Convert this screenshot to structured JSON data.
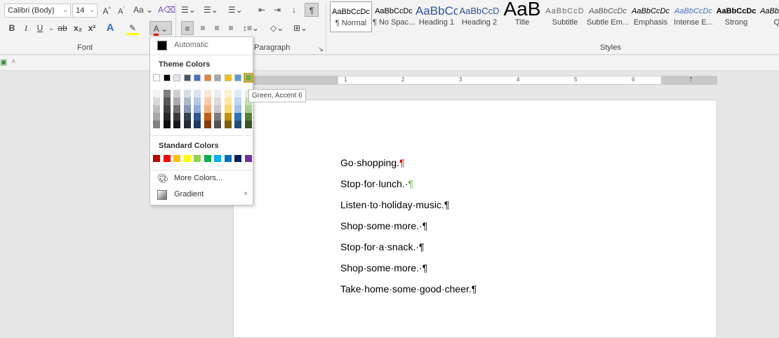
{
  "ribbon": {
    "font_name": "Calibri (Body)",
    "font_size": "14",
    "case_label": "Aa",
    "font_group": "Font",
    "paragraph_group": "Paragraph",
    "styles_group": "Styles",
    "bold": "B",
    "italic": "I",
    "underline": "U",
    "strike": "ab",
    "subscript": "x₂",
    "superscript": "x²",
    "styles": [
      {
        "preview": "AaBbCcDc",
        "name": "¶ Normal"
      },
      {
        "preview": "AaBbCcDc",
        "name": "¶ No Spac..."
      },
      {
        "preview": "AaBbCc",
        "name": "Heading 1"
      },
      {
        "preview": "AaBbCcD",
        "name": "Heading 2"
      },
      {
        "preview": "AaB",
        "name": "Title"
      },
      {
        "preview": "AaBbCcD",
        "name": "Subtitle"
      },
      {
        "preview": "AaBbCcDc",
        "name": "Subtle Em..."
      },
      {
        "preview": "AaBbCcDc",
        "name": "Emphasis"
      },
      {
        "preview": "AaBbCcDc",
        "name": "Intense E..."
      },
      {
        "preview": "AaBbCcDc",
        "name": "Strong"
      },
      {
        "preview": "AaBbCcDc",
        "name": "Qu"
      }
    ]
  },
  "ruler": {
    "numbers": [
      "1",
      "2",
      "3",
      "4",
      "5",
      "6",
      "7"
    ]
  },
  "font_color_menu": {
    "automatic": "Automatic",
    "theme_header": "Theme Colors",
    "standard_header": "Standard Colors",
    "more_colors": "More Colors...",
    "gradient": "Gradient",
    "tooltip": "Green, Accent 6",
    "theme_colors": [
      "#ffffff",
      "#000000",
      "#e7e6e6",
      "#44546a",
      "#4472c4",
      "#ed7d31",
      "#a5a5a5",
      "#ffc000",
      "#5b9bd5",
      "#70ad47"
    ],
    "theme_shades": [
      [
        "#f2f2f2",
        "#d9d9d9",
        "#bfbfbf",
        "#a6a6a6",
        "#808080"
      ],
      [
        "#7f7f7f",
        "#595959",
        "#404040",
        "#262626",
        "#0d0d0d"
      ],
      [
        "#d0cece",
        "#aeabab",
        "#757070",
        "#3a3838",
        "#171616"
      ],
      [
        "#d6dce5",
        "#adb9ca",
        "#8497b0",
        "#333f50",
        "#222a35"
      ],
      [
        "#dae3f3",
        "#b4c7e7",
        "#8faadc",
        "#2f5597",
        "#203864"
      ],
      [
        "#fbe5d6",
        "#f8cbad",
        "#f4b183",
        "#c55a11",
        "#843c0c"
      ],
      [
        "#ededed",
        "#dbdbdb",
        "#c9c9c9",
        "#7b7b7b",
        "#525252"
      ],
      [
        "#fff2cc",
        "#ffe699",
        "#ffd966",
        "#bf9000",
        "#7f6000"
      ],
      [
        "#deebf7",
        "#bdd7ee",
        "#9dc3e6",
        "#2e75b6",
        "#1f4e79"
      ],
      [
        "#e2f0d9",
        "#c5e0b4",
        "#a9d18e",
        "#548235",
        "#385723"
      ]
    ],
    "standard_colors": [
      "#c00000",
      "#ff0000",
      "#ffc000",
      "#ffff00",
      "#92d050",
      "#00b050",
      "#00b0f0",
      "#0070c0",
      "#002060",
      "#7030a0"
    ]
  },
  "document": {
    "lines": [
      {
        "text": "Go·shopping.",
        "mark": "¶",
        "mark_color": "#e00000"
      },
      {
        "text": "Stop·for·lunch.·",
        "mark": "¶",
        "mark_color": "#70ad47"
      },
      {
        "text": "Listen·to·holiday·music.",
        "mark": "¶",
        "mark_color": "#000000"
      },
      {
        "text": "Shop·some·more.·",
        "mark": "¶",
        "mark_color": "#000000"
      },
      {
        "text": "Stop·for·a·snack.·",
        "mark": "¶",
        "mark_color": "#000000"
      },
      {
        "text": "Shop·some·more.·",
        "mark": "¶",
        "mark_color": "#000000"
      },
      {
        "text": "Take·home·some·good·cheer.",
        "mark": "¶",
        "mark_color": "#000000"
      }
    ]
  }
}
